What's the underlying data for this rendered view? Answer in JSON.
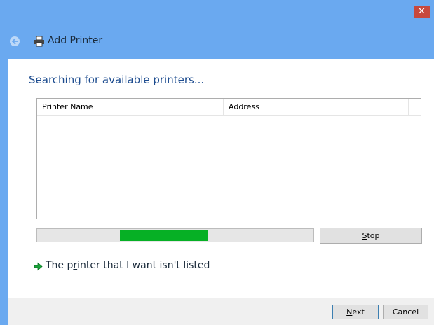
{
  "window": {
    "close_glyph": "✕"
  },
  "header": {
    "title": "Add Printer",
    "back_icon": "back-arrow-icon",
    "printer_icon": "printer-icon"
  },
  "main": {
    "heading": "Searching for available printers...",
    "list": {
      "columns": [
        "Printer Name",
        "Address"
      ],
      "rows": []
    },
    "progress": {
      "indeterminate": true,
      "fill_start_fraction": 0.3,
      "fill_end_fraction": 0.62,
      "color": "#06b025"
    },
    "stop_button": {
      "mnemonic": "S",
      "rest": "top"
    },
    "not_listed_link": {
      "before": "The p",
      "mnemonic": "r",
      "after": "inter that I want isn't listed",
      "icon": "green-arrow-icon"
    }
  },
  "footer": {
    "next_button": {
      "mnemonic": "N",
      "rest": "ext"
    },
    "cancel_button": "Cancel"
  },
  "colors": {
    "title_bar": "#6aa9f0",
    "heading": "#1d4c8f",
    "close": "#c7483d"
  }
}
